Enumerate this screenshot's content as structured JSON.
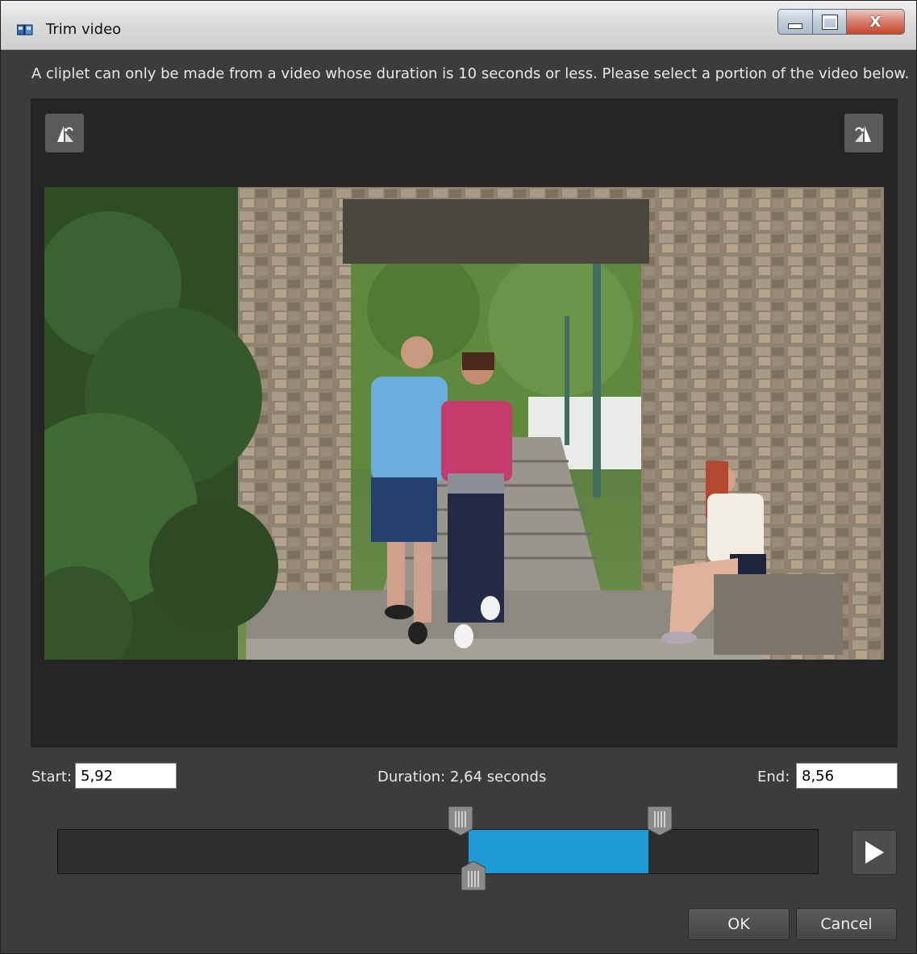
{
  "window": {
    "title": "Trim video",
    "controls": {
      "minimize": "minimize",
      "maximize": "maximize",
      "close": "close"
    }
  },
  "instructions": "A cliplet can only be made from a video whose duration is 10 seconds or less. Please select a portion of the video below.",
  "toolbar": {
    "rotate_left_icon": "rotate-left-icon",
    "rotate_right_icon": "rotate-right-icon"
  },
  "trim": {
    "start_label": "Start:",
    "start_value": "5,92",
    "duration_text": "Duration: 2,64 seconds",
    "end_label": "End:",
    "end_value": "8,56",
    "selection_start_fraction": 0.54,
    "selection_end_fraction": 0.777,
    "playhead_fraction": 0.54
  },
  "buttons": {
    "ok": "OK",
    "cancel": "Cancel"
  },
  "colors": {
    "selection": "#1e9ad6",
    "background": "#3c3c3c",
    "stage": "#252526"
  }
}
